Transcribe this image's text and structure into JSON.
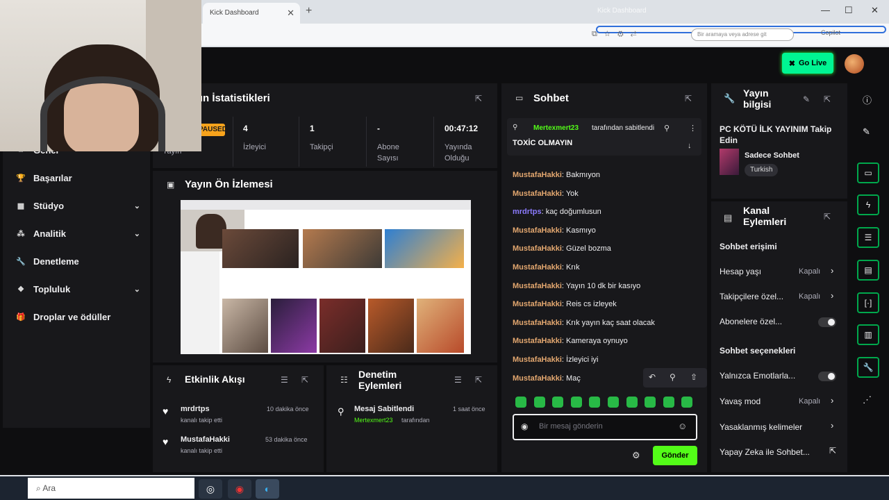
{
  "browser": {
    "tab_title": "Kick Dashboard",
    "tab_close": "✕",
    "new_tab": "+",
    "window_title": "Kick Dashboard",
    "search_placeholder": "Bir aramaya veya adrese git",
    "copilot": "Copilot"
  },
  "topbar": {
    "go_live": "Go Live"
  },
  "sidebar": {
    "items": [
      {
        "icon": "home-icon",
        "label": "Genel",
        "chev": ""
      },
      {
        "icon": "trophy-icon",
        "label": "Başarılar",
        "chev": ""
      },
      {
        "icon": "studio-icon",
        "label": "Stüdyo",
        "chev": "⌄"
      },
      {
        "icon": "analytics-icon",
        "label": "Analitik",
        "chev": "⌄"
      },
      {
        "icon": "wrench-icon",
        "label": "Denetleme",
        "chev": ""
      },
      {
        "icon": "community-icon",
        "label": "Topluluk",
        "chev": "⌄"
      },
      {
        "icon": "gift-icon",
        "label": "Droplar ve ödüller",
        "chev": ""
      }
    ]
  },
  "stats": {
    "title": "Yayın İstatistikleri",
    "badge": "PAUSED",
    "status_label": "Yayın",
    "items": [
      {
        "value": "4",
        "label": "İzleyici"
      },
      {
        "value": "1",
        "label": "Takipçi"
      },
      {
        "value": "-",
        "label": "Abone Sayısı"
      },
      {
        "value": "00:47:12",
        "label": "Yayında Olduğu"
      }
    ]
  },
  "preview": {
    "title": "Yayın Ön İzlemesi"
  },
  "activity": {
    "title": "Etkinlik Akışı",
    "items": [
      {
        "user": "mrdrtps",
        "text": "kanalı takip etti",
        "time": "10 dakika önce"
      },
      {
        "user": "MustafaHakki",
        "text": "kanalı takip etti",
        "time": "53 dakika önce"
      }
    ]
  },
  "mod_actions": {
    "title": "Denetim Eylemleri",
    "items": [
      {
        "title": "Mesaj Sabitlendi",
        "user": "Mertexmert23",
        "suffix": "tarafından",
        "time": "1 saat önce"
      }
    ]
  },
  "chat": {
    "title": "Sohbet",
    "pinned": {
      "by": "Mertexmert23",
      "by_suffix": "tarafından sabitlendi",
      "text": "TOXİC OLMAYIN"
    },
    "messages": [
      {
        "user": "MustafaHakki",
        "text": "Bakmıyon",
        "color": "#e3a76f"
      },
      {
        "user": "MustafaHakki",
        "text": "Yok",
        "color": "#e3a76f"
      },
      {
        "user": "mrdrtps",
        "text": "kaç doğumlusun",
        "color": "#8c7bff"
      },
      {
        "user": "MustafaHakki",
        "text": "Kasmıyo",
        "color": "#e3a76f"
      },
      {
        "user": "MustafaHakki",
        "text": "Güzel bozma",
        "color": "#e3a76f"
      },
      {
        "user": "MustafaHakki",
        "text": "Krık",
        "color": "#e3a76f"
      },
      {
        "user": "MustafaHakki",
        "text": "Yayın 10 dk bir kasıyo",
        "color": "#e3a76f"
      },
      {
        "user": "MustafaHakki",
        "text": "Reis cs izleyek",
        "color": "#e3a76f"
      },
      {
        "user": "MustafaHakki",
        "text": "Krık yayın kaç saat olacak",
        "color": "#e3a76f"
      },
      {
        "user": "MustafaHakki",
        "text": "Kameraya oynuyo",
        "color": "#e3a76f"
      },
      {
        "user": "MustafaHakki",
        "text": "İzleyici iyi",
        "color": "#e3a76f"
      },
      {
        "user": "MustafaHakki",
        "text": "Maç",
        "color": "#e3a76f"
      }
    ],
    "input_placeholder": "Bir mesaj gönderin",
    "send": "Gönder"
  },
  "stream_info": {
    "title": "Yayın bilgisi",
    "stream_title": "PC KÖTÜ İLK YAYINIM Takip Edin",
    "category": "Sadece Sohbet",
    "language": "Turkish"
  },
  "channel_actions": {
    "title": "Kanal Eylemleri",
    "chat_access": "Sohbet erişimi",
    "rows1": [
      {
        "label": "Hesap yaşı",
        "state": "Kapalı",
        "type": "arrow"
      },
      {
        "label": "Takipçilere özel...",
        "state": "Kapalı",
        "type": "arrow"
      },
      {
        "label": "Abonelere özel...",
        "state": "",
        "type": "toggle"
      }
    ],
    "chat_options": "Sohbet seçenekleri",
    "rows2": [
      {
        "label": "Yalnızca Emotlarla...",
        "state": "",
        "type": "toggle"
      },
      {
        "label": "Yavaş mod",
        "state": "Kapalı",
        "type": "arrow"
      },
      {
        "label": "Yasaklanmış kelimeler",
        "state": "",
        "type": "arrow"
      },
      {
        "label": "Yapay Zeka ile Sohbet...",
        "state": "",
        "type": "ext"
      }
    ]
  },
  "taskbar": {
    "search": "Ara"
  }
}
